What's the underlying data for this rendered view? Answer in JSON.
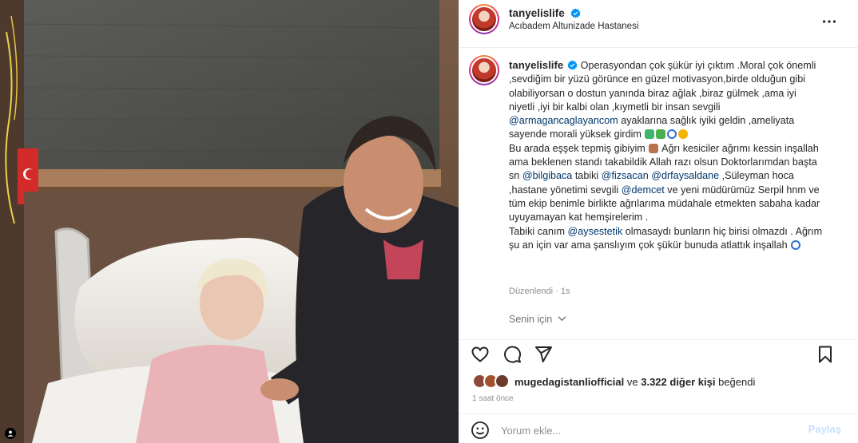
{
  "post": {
    "username": "tanyelislife",
    "location": "Acıbadem Altunizade Hastanesi"
  },
  "caption": {
    "username": "tanyelislife",
    "p1": "Operasyondan çok şükür iyi çıktım .Moral çok önemli ,sevdiğim bir yüzü görünce en güzel motivasyon,birde olduğun gibi olabiliyorsan o dostun yanında biraz ağlak ,biraz gülmek ,ama iyi niyetli ,iyi bir kalbi olan ,kıymetli bir insan sevgili",
    "m1": "@armagancaglayancom",
    "p2": "ayaklarına sağlık iyiki geldin ,ameliyata sayende morali yüksek girdim",
    "p3": "Bu arada eşşek tepmiş gibiyim",
    "p4": "Ağrı kesiciler ağrımı kessin inşallah ama beklenen standı takabildik Allah razı olsun Doktorlarımdan başta sn",
    "m2": "@bilgibaca",
    "p5": "tabiki",
    "m3": "@fizsacan",
    "m4": "@drfaysaldane",
    "p6": ",Süleyman hoca ,hastane yönetimi sevgili",
    "m5": "@demcet",
    "p7": "ve yeni müdürümüz Serpil hnm ve tüm ekip benimle birlikte ağrılarıma müdahale etmekten sabaha kadar uyuyamayan kat hemşirelerim .",
    "p8": "Tabiki canım",
    "m6": "@aysestetik",
    "p9": "olmasaydı bunların hiç birisi olmazdı . Ağrım şu an için var ama şanslıyım çok şükür bunuda atlattık inşallah",
    "edited": "Düzenlendi",
    "dot": "·",
    "age": "1s"
  },
  "translate_label": "Senin için",
  "icons": [
    "heart-icon",
    "comment-icon",
    "share-icon",
    "bookmark-icon",
    "more-icon",
    "verified-icon",
    "emoji-icon"
  ],
  "likes": {
    "first_user": "mugedagistanliofficial",
    "connector": "ve",
    "others": "3.322 diğer kişi",
    "suffix": "beğendi"
  },
  "timestamp": "1 saat önce",
  "comment": {
    "placeholder": "Yorum ekle...",
    "post_label": "Paylaş"
  },
  "colors": {
    "mention": "#00376b",
    "verified": "#0095f6",
    "post_disabled": "#c7e0fd"
  }
}
